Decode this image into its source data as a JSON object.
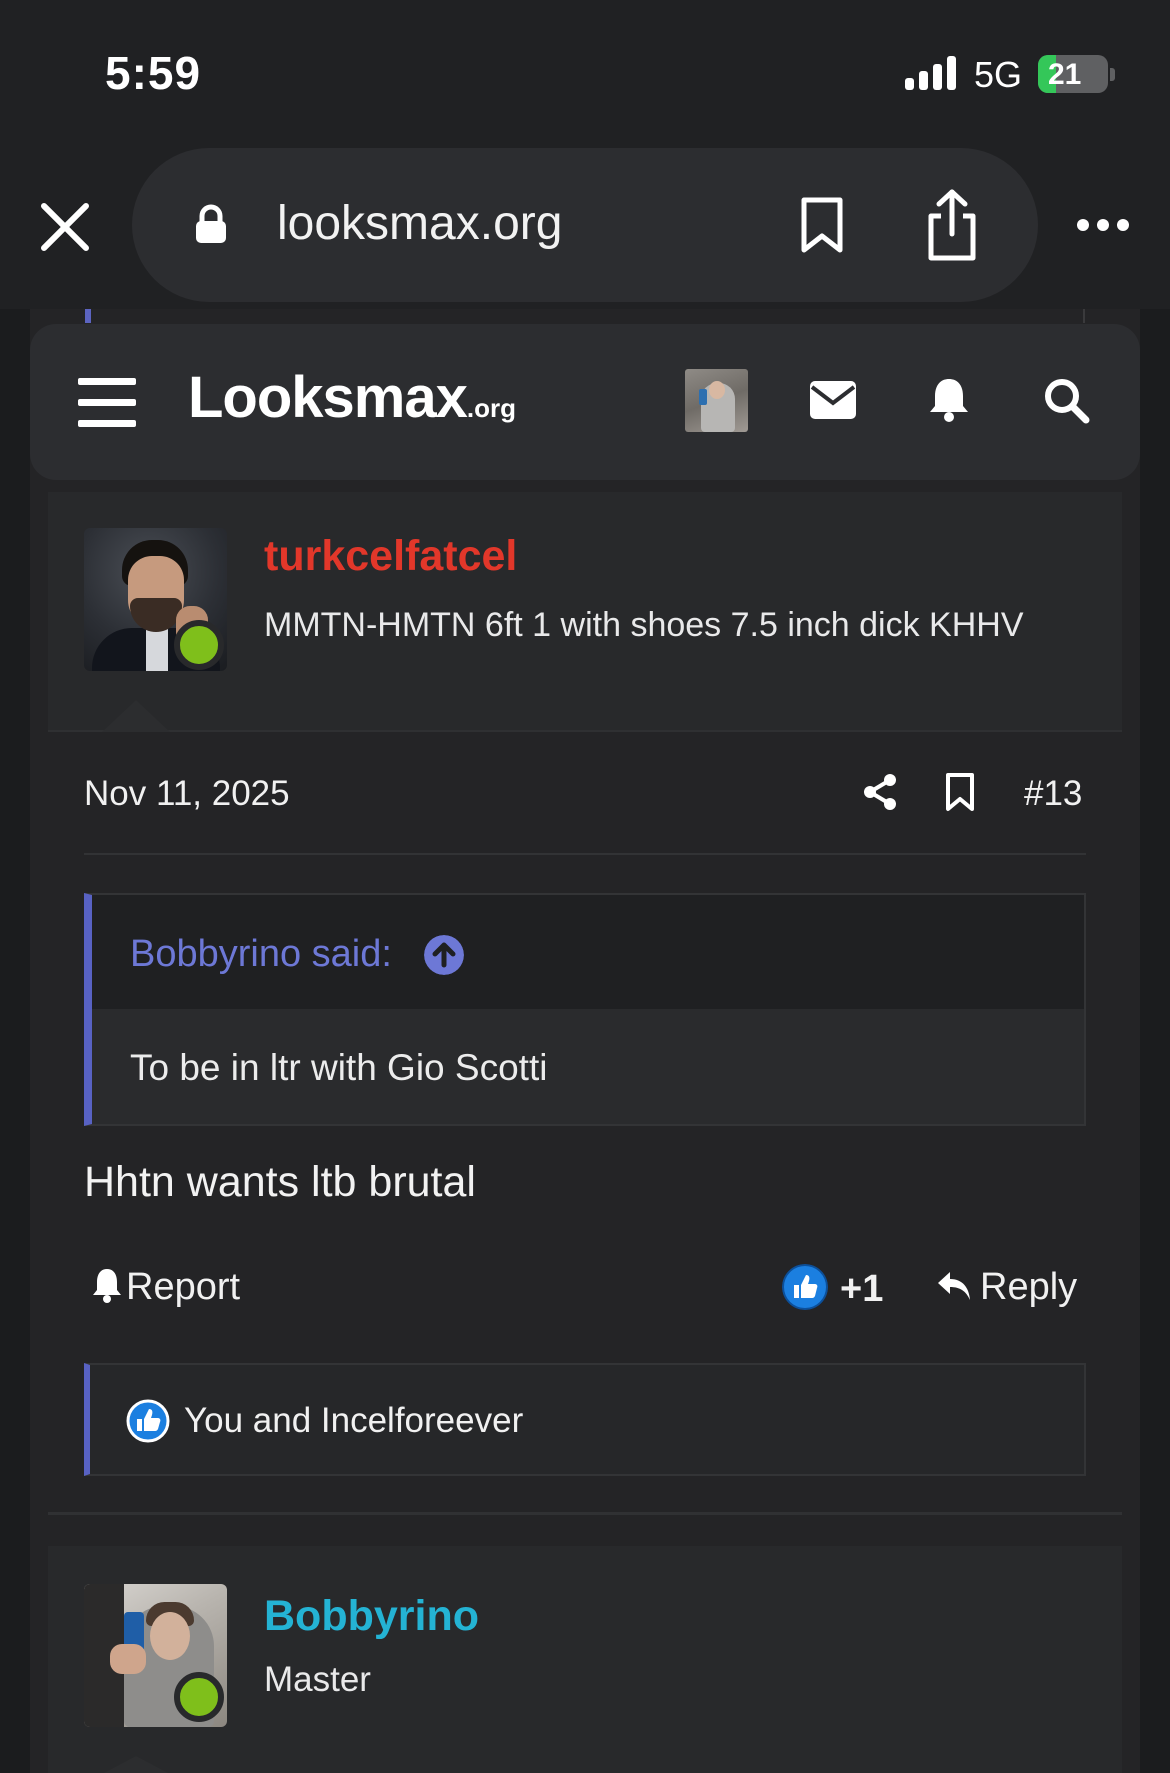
{
  "status_bar": {
    "time": "5:59",
    "network": "5G",
    "battery": "21",
    "battery_color": "#34c759"
  },
  "browser": {
    "url": "looksmax.org",
    "close_icon": "close-icon",
    "lock_icon": "lock-icon",
    "bookmark_icon": "bookmark-icon",
    "share_icon": "share-icon",
    "more_icon": "more-icon"
  },
  "site_header": {
    "logo": "Looksmax",
    "logo_suffix": ".org",
    "icons": [
      "menu-icon",
      "avatar",
      "mail-icon",
      "bell-icon",
      "search-icon"
    ]
  },
  "posts": [
    {
      "username": "turkcelfatcel",
      "username_color": "#e2372a",
      "user_title": "MMTN-HMTN 6ft 1 with shoes 7.5 inch dick KHHV",
      "date": "Nov 11, 2025",
      "post_number": "#13",
      "quote": {
        "author": "Bobbyrino said:",
        "text": "To be in ltr with Gio Scotti"
      },
      "text": "Hhtn wants ltb brutal",
      "actions": {
        "report": "Report",
        "like_count": "+1",
        "reply": "Reply"
      },
      "reactions": "You and Incelforeever"
    },
    {
      "username": "Bobbyrino",
      "username_color": "#24b3d4",
      "user_title": "Master"
    }
  ],
  "accent_color": "#5862c3"
}
